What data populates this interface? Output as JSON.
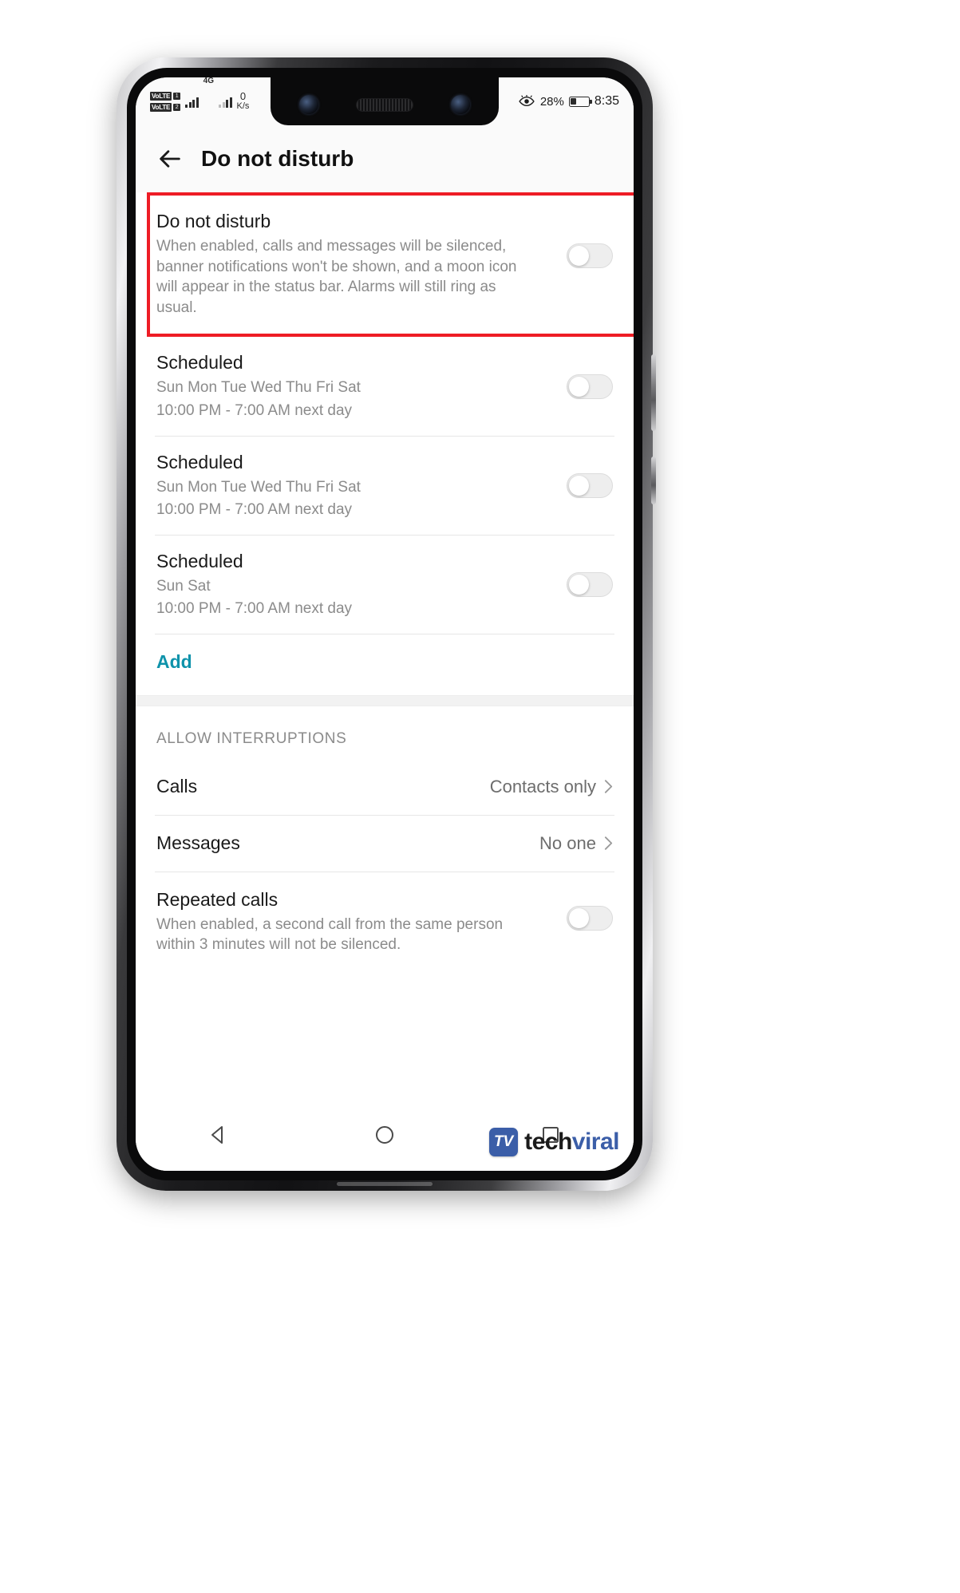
{
  "status_bar": {
    "volte_1_label": "VoLTE",
    "volte_1_sim": "1",
    "volte_2_label": "VoLTE",
    "volte_2_sim": "2",
    "network_type": "4G",
    "data_speed_value": "0",
    "data_speed_unit": "K/s",
    "eye_comfort_icon": "eye-icon",
    "battery_percent": "28%",
    "clock": "8:35"
  },
  "app_bar": {
    "back_icon": "back-arrow-icon",
    "title": "Do not disturb"
  },
  "dnd": {
    "title": "Do not disturb",
    "description": "When enabled, calls and messages will be silenced, banner notifications won't be shown, and a moon icon will appear in the status bar. Alarms will still ring as usual.",
    "toggle_state": "off",
    "highlight_color": "#ee1c25"
  },
  "schedules": [
    {
      "title": "Scheduled",
      "days": "Sun Mon Tue Wed Thu Fri Sat",
      "time": "10:00 PM - 7:00 AM next day",
      "toggle_state": "off"
    },
    {
      "title": "Scheduled",
      "days": "Sun Mon Tue Wed Thu Fri Sat",
      "time": "10:00 PM - 7:00 AM next day",
      "toggle_state": "off"
    },
    {
      "title": "Scheduled",
      "days": "Sun Sat",
      "time": "10:00 PM - 7:00 AM next day",
      "toggle_state": "off"
    }
  ],
  "add_label": "Add",
  "add_color": "#0f93ab",
  "allow_interruptions": {
    "header": "ALLOW INTERRUPTIONS",
    "calls": {
      "label": "Calls",
      "value": "Contacts only",
      "chevron": "chevron-right-icon"
    },
    "messages": {
      "label": "Messages",
      "value": "No one",
      "chevron": "chevron-right-icon"
    },
    "repeated_calls": {
      "label": "Repeated calls",
      "description": "When enabled, a second call from the same person within 3 minutes will not be silenced.",
      "toggle_state": "off"
    }
  },
  "nav_bar": {
    "back": "nav-back-triangle-icon",
    "home": "nav-home-circle-icon",
    "recents": "nav-recents-square-icon"
  },
  "watermark": {
    "logo_letters": "TV",
    "text_first": "tech",
    "text_second": "viral",
    "brand_color": "#3b5ea8"
  }
}
